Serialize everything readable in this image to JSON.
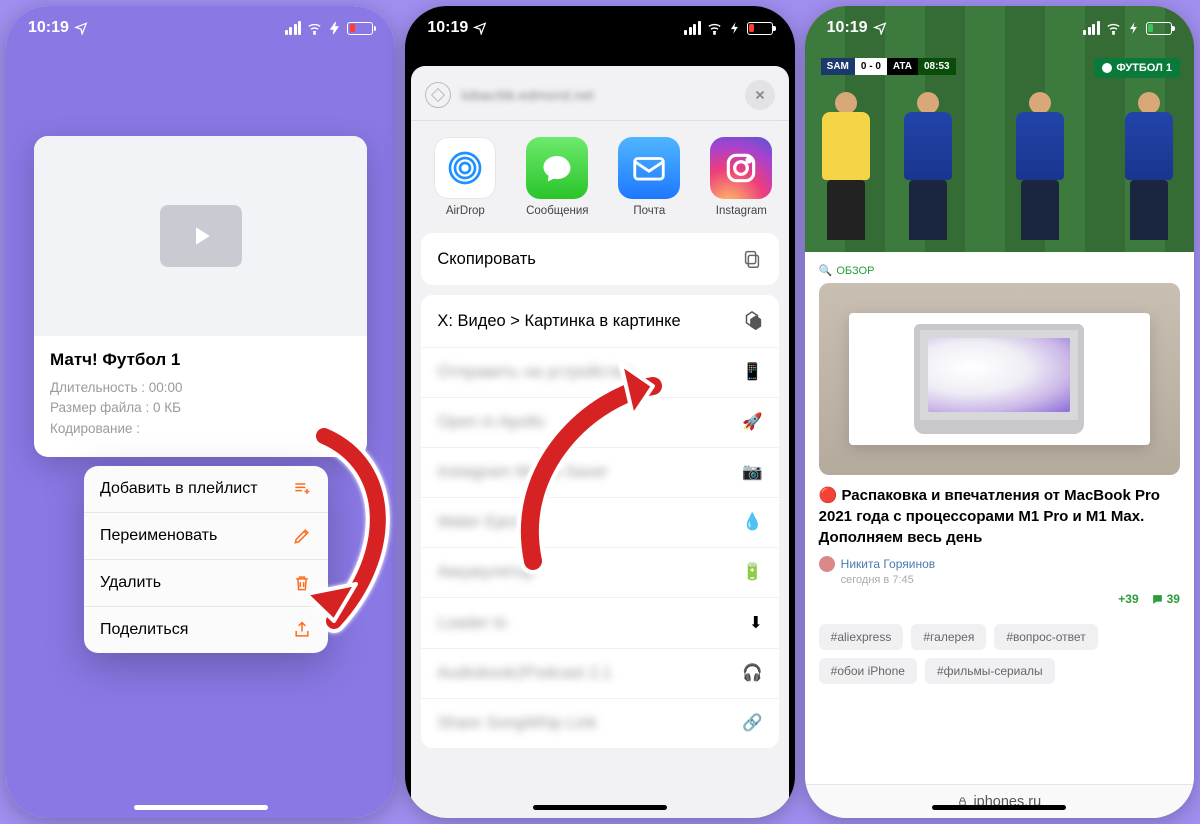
{
  "status": {
    "time": "10:19"
  },
  "phone1": {
    "card": {
      "title": "Матч! Футбол 1",
      "duration_label": "Длительность : 00:00",
      "size_label": "Размер файла : 0 КБ",
      "encoding_label": "Кодирование :"
    },
    "menu": {
      "add": "Добавить в плейлист",
      "rename": "Переименовать",
      "delete": "Удалить",
      "share": "Поделиться"
    }
  },
  "phone2": {
    "apps": {
      "airdrop": "AirDrop",
      "messages": "Сообщения",
      "mail": "Почта",
      "instagram": "Instagram"
    },
    "actions": {
      "copy": "Скопировать",
      "pip": "X: Видео > Картинка в картинке"
    }
  },
  "phone3": {
    "score": {
      "team1": "SAM",
      "s1": "0 - 0",
      "team2": "ATA",
      "clock": "08:53"
    },
    "channel": "ФУТБОЛ 1",
    "obzor": "ОБЗОР",
    "article": {
      "title": "🔴  Распаковка и впечатления от MacBook Pro 2021 года с процессорами M1 Pro и M1 Max. Дополняем весь день",
      "author": "Никита Горяинов",
      "date": "сегодня в 7:45",
      "likes": "+39",
      "comments": "39"
    },
    "tags": {
      "t1": "#aliexpress",
      "t2": "#галерея",
      "t3": "#вопрос-ответ",
      "t4": "#обои iPhone",
      "t5": "#фильмы-сериалы"
    },
    "domain": "iphones.ru"
  }
}
